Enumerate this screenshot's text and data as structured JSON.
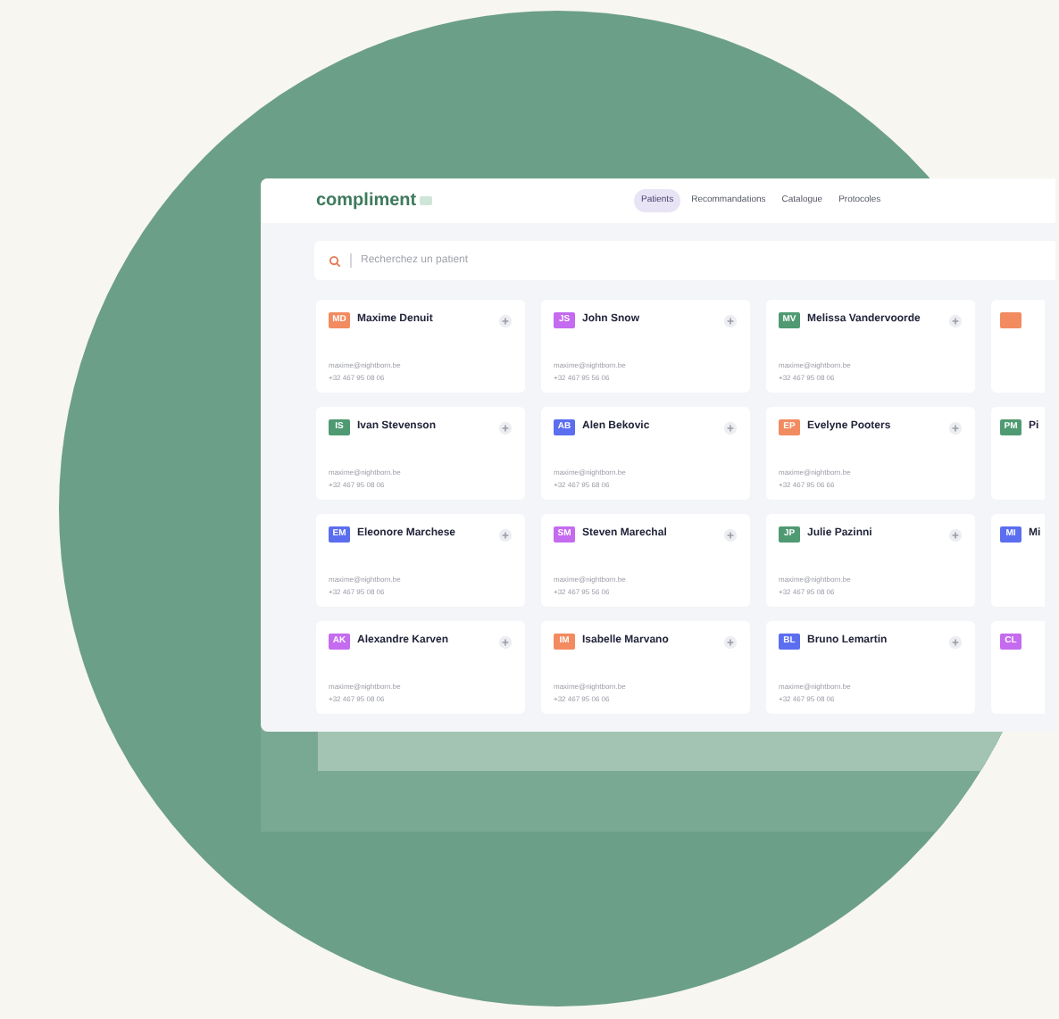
{
  "app": {
    "logo": "compliment"
  },
  "nav": [
    {
      "label": "Patients",
      "selected": true
    },
    {
      "label": "Recommandations",
      "selected": false
    },
    {
      "label": "Catalogue",
      "selected": false
    },
    {
      "label": "Protocoles",
      "selected": false
    }
  ],
  "search": {
    "placeholder": "Recherchez un patient"
  },
  "patients": [
    {
      "initials": "MD",
      "color": "#f28b60",
      "name": "Maxime Denuit",
      "email": "maxime@nightborn.be",
      "phone": "+32 467 95 08 06"
    },
    {
      "initials": "JS",
      "color": "#c46bf0",
      "name": "John Snow",
      "email": "maxime@nightborn.be",
      "phone": "+32 467 95 56 06"
    },
    {
      "initials": "MV",
      "color": "#4f9a72",
      "name": "Melissa Vandervoorde",
      "email": "maxime@nightborn.be",
      "phone": "+32 467 95 08 06"
    },
    {
      "initials": "IS",
      "color": "#4f9a72",
      "name": "Ivan Stevenson",
      "email": "maxime@nightborn.be",
      "phone": "+32 467 95 08 06"
    },
    {
      "initials": "AB",
      "color": "#5b6ef0",
      "name": "Alen Bekovic",
      "email": "maxime@nightborn.be",
      "phone": "+32 467 95 68 06"
    },
    {
      "initials": "EP",
      "color": "#f28b60",
      "name": "Evelyne Pooters",
      "email": "maxime@nightborn.be",
      "phone": "+32 467 95 06 66"
    },
    {
      "initials": "EM",
      "color": "#5b6ef0",
      "name": "Eleonore Marchese",
      "email": "maxime@nightborn.be",
      "phone": "+32 467 95 08 06"
    },
    {
      "initials": "SM",
      "color": "#c46bf0",
      "name": "Steven Marechal",
      "email": "maxime@nightborn.be",
      "phone": "+32 467 95 56 06"
    },
    {
      "initials": "JP",
      "color": "#4f9a72",
      "name": "Julie Pazinni",
      "email": "maxime@nightborn.be",
      "phone": "+32 467 95 08 06"
    },
    {
      "initials": "AK",
      "color": "#c46bf0",
      "name": "Alexandre Karven",
      "email": "maxime@nightborn.be",
      "phone": "+32 467 95 08 06"
    },
    {
      "initials": "IM",
      "color": "#f28b60",
      "name": "Isabelle Marvano",
      "email": "maxime@nightborn.be",
      "phone": "+32 467 95 06 06"
    },
    {
      "initials": "BL",
      "color": "#5b6ef0",
      "name": "Bruno Lemartin",
      "email": "maxime@nightborn.be",
      "phone": "+32 467 95 08 06"
    }
  ],
  "partial_cards": [
    {
      "color": "#f28b60"
    },
    {
      "initials": "PM",
      "color": "#4f9a72",
      "name": "Pi"
    },
    {
      "initials": "MI",
      "color": "#5b6ef0",
      "name": "Mi"
    },
    {
      "initials": "CL",
      "color": "#c46bf0"
    }
  ]
}
